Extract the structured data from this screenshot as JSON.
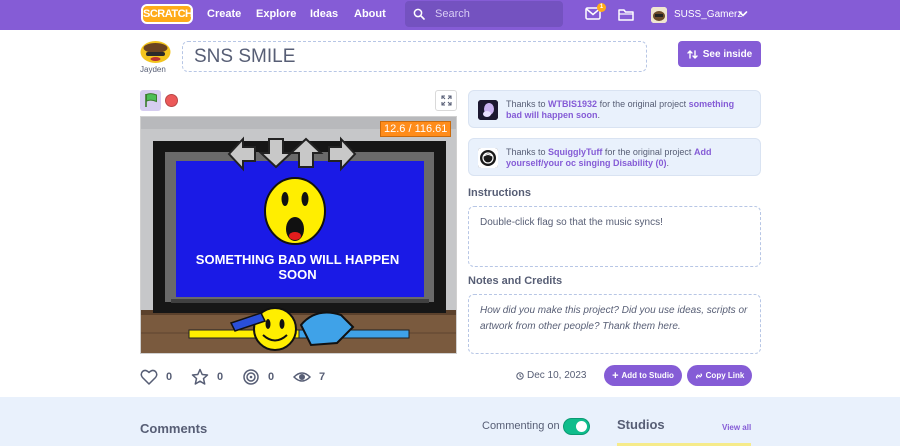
{
  "nav": {
    "logo": "SCRATCH",
    "links": [
      "Create",
      "Explore",
      "Ideas",
      "About"
    ],
    "search_placeholder": "Search",
    "message_count": "1",
    "username": "SUSS_Gamerz"
  },
  "project": {
    "author": "Jayden",
    "title": "SNS SMILE",
    "see_inside": "See inside",
    "timer": "12.6 / 116.61",
    "screen_text": "SOMETHING BAD WILL HAPPEN SOON"
  },
  "stats": {
    "loves": "0",
    "favorites": "0",
    "remixes": "0",
    "views": "7",
    "date": "Dec 10, 2023",
    "add_to_studio": "Add to Studio",
    "copy_link": "Copy Link"
  },
  "credits": [
    {
      "prefix": "Thanks to",
      "user": "WTBIS1932",
      "middle": "for the original project",
      "project": "something bad will happen soon",
      "suffix": "."
    },
    {
      "prefix": "Thanks to",
      "user": "SquigglyTuff",
      "middle": "for the original project",
      "project": "Add yourself/your oc singing Disability (0)",
      "suffix": "."
    }
  ],
  "instructions": {
    "title": "Instructions",
    "text": "Double-click flag so that the music syncs!"
  },
  "notes": {
    "title": "Notes and Credits",
    "placeholder": "How did you make this project? Did you use ideas, scripts or artwork from other people? Thank them here."
  },
  "bottom": {
    "comments_title": "Comments",
    "commenting_label": "Commenting on",
    "studios_title": "Studios",
    "view_all": "View all"
  },
  "colors": {
    "brand": "#855cd6",
    "accent_orange": "#ff8c1a",
    "toggle_on": "#0fbd8c"
  }
}
